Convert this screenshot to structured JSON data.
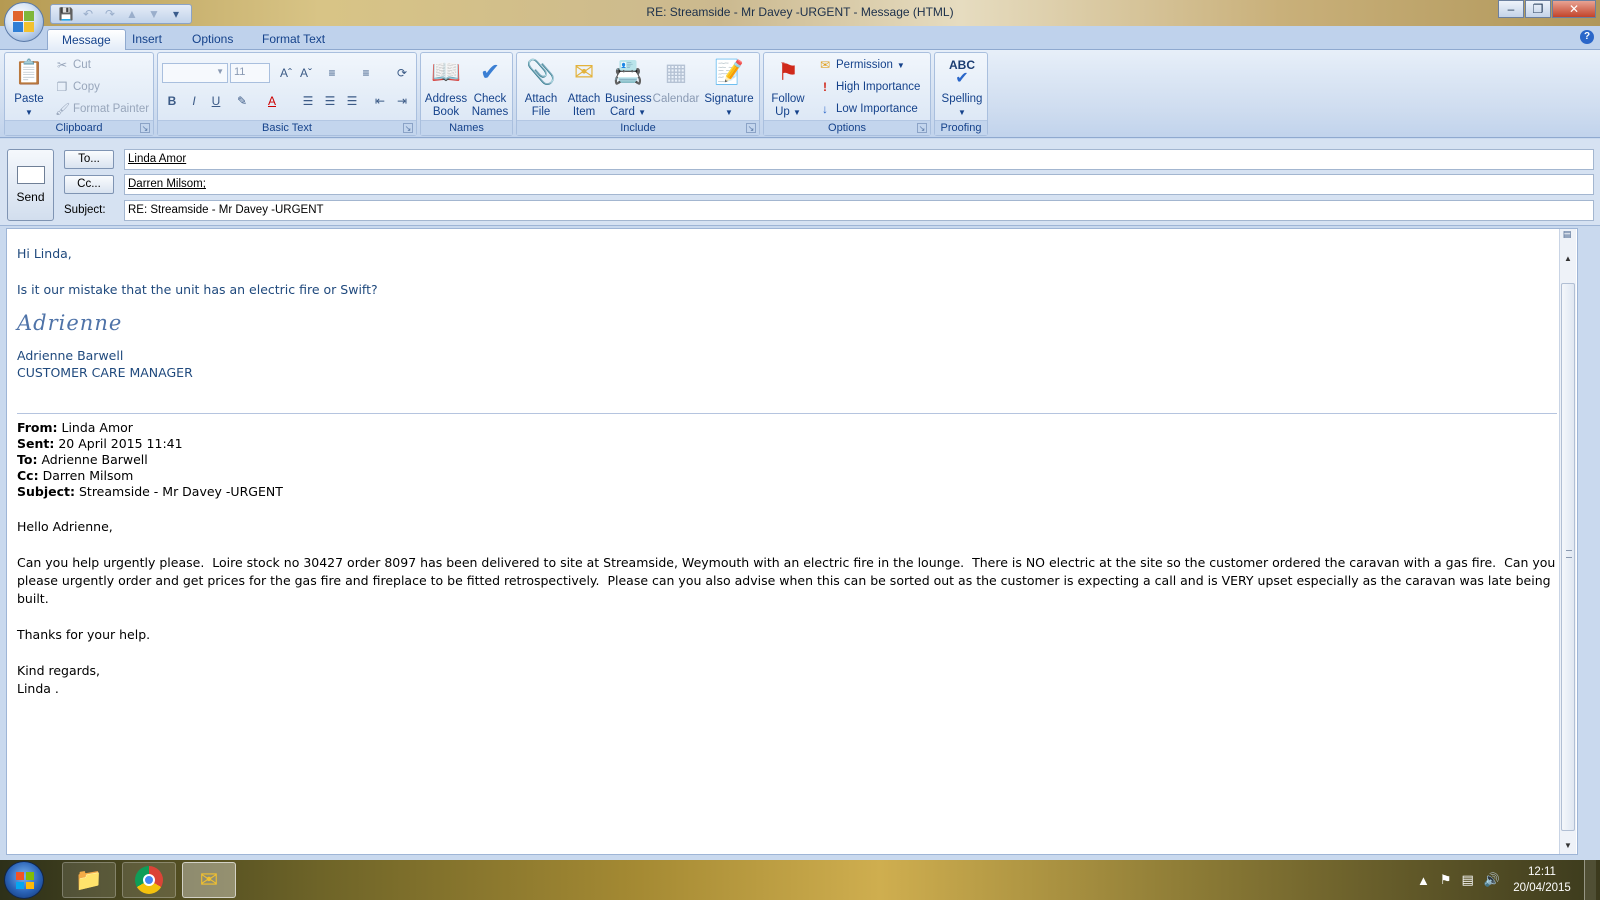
{
  "window": {
    "title": "RE: Streamside - Mr Davey -URGENT - Message (HTML)"
  },
  "ribbon_tabs": [
    "Message",
    "Insert",
    "Options",
    "Format Text"
  ],
  "clipboard": {
    "paste": "Paste",
    "cut": "Cut",
    "copy": "Copy",
    "format_painter": "Format Painter",
    "label": "Clipboard"
  },
  "basic_text": {
    "font_size": "11",
    "label": "Basic Text"
  },
  "names": {
    "address_book_1": "Address",
    "address_book_2": "Book",
    "check_names_1": "Check",
    "check_names_2": "Names",
    "label": "Names"
  },
  "include": {
    "attach_file_1": "Attach",
    "attach_file_2": "File",
    "attach_item_1": "Attach",
    "attach_item_2": "Item",
    "business_card_1": "Business",
    "business_card_2": "Card",
    "calendar": "Calendar",
    "signature": "Signature",
    "label": "Include"
  },
  "options": {
    "follow_up_1": "Follow",
    "follow_up_2": "Up",
    "permission": "Permission",
    "high": "High Importance",
    "low": "Low Importance",
    "label": "Options"
  },
  "proofing": {
    "spelling": "Spelling",
    "abc": "ABC",
    "label": "Proofing"
  },
  "compose": {
    "send": "Send",
    "to_button": "To...",
    "cc_button": "Cc...",
    "subject_label": "Subject:",
    "to_value": "Linda Amor",
    "cc_value": "Darren Milsom;",
    "subject_value": "RE: Streamside - Mr Davey -URGENT"
  },
  "body": {
    "greeting": "Hi Linda,",
    "question": "Is it our mistake that the unit has an electric fire or Swift?",
    "signature_script": "Adrienne",
    "sig_name": "Adrienne Barwell",
    "sig_title": "CUSTOMER CARE MANAGER",
    "from_label": "From:",
    "from_value": "Linda Amor",
    "sent_label": "Sent:",
    "sent_value": "20 April 2015 11:41",
    "to_label": "To:",
    "to_value": "Adrienne Barwell",
    "cc_label": "Cc:",
    "cc_value": "Darren Milsom",
    "subject_label": "Subject:",
    "subject_value": "Streamside - Mr Davey -URGENT",
    "hello": "Hello Adrienne,",
    "para1": "Can you help urgently please.  Loire stock no 30427 order 8097 has been delivered to site at Streamside, Weymouth with an electric fire in the lounge.  There is NO electric at the site so the customer ordered the caravan with a gas fire.  Can you please urgently order and get prices for the gas fire and fireplace to be fitted retrospectively.  Please can you also advise when this can be sorted out as the customer is expecting a call and is VERY upset especially as the caravan was late being built.",
    "thanks": "Thanks for your help.",
    "kind": "Kind regards,",
    "linda": "Linda ."
  },
  "taskbar": {
    "time": "12:11",
    "date": "20/04/2015"
  },
  "colors": {
    "body_text_blue": "#1f497d",
    "ribbon_text": "#15428b"
  }
}
